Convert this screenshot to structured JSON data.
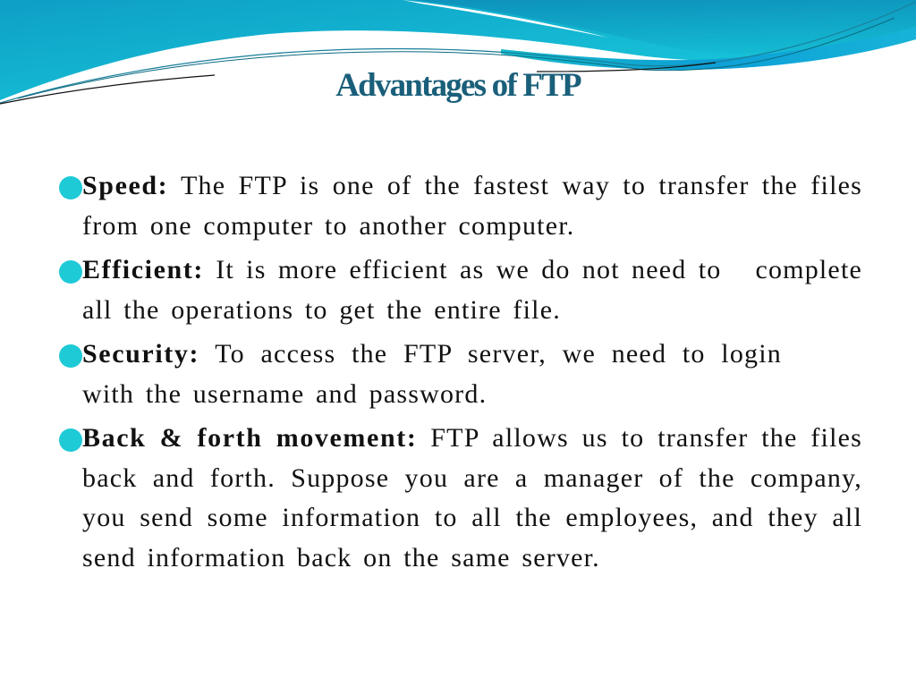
{
  "slide": {
    "title": "Advantages of FTP",
    "accent_color": "#1ecad6",
    "title_color": "#1a5f7a",
    "bullets": [
      {
        "term": "Speed:",
        "text": "The FTP is one of the fastest way to transfer the files from one computer to another computer."
      },
      {
        "term": "Efficient:",
        "text_a": "It is more efficient as we do not need to",
        "text_b": "complete all the operations to get the entire file."
      },
      {
        "term": "Security:",
        "text_a": "To access the FTP server, we need to login",
        "text_b": "with the username and password."
      },
      {
        "term": "Back & forth movement:",
        "text": "FTP allows us to transfer the files back and forth. Suppose you are a manager of the company, you send some information to all the employees, and they all send information back on the same server."
      }
    ]
  }
}
